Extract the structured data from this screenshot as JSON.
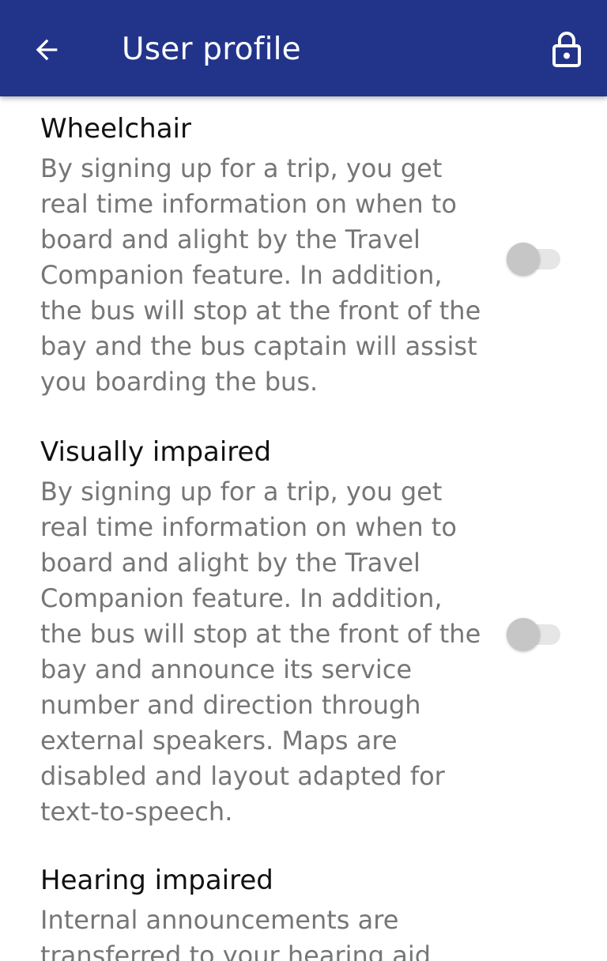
{
  "header": {
    "title": "User profile",
    "back_icon": "arrow-left-icon",
    "lock_icon": "lock-icon",
    "bg_color": "#22348a"
  },
  "preferences": [
    {
      "title": "Wheelchair",
      "description": "By signing up for a trip, you get real time information on when to board and alight by the Travel Companion feature. In addition, the bus will stop at the front of the bay and the bus captain will assist you boarding the bus.",
      "enabled": false
    },
    {
      "title": "Visually impaired",
      "description": "By signing up for a trip, you get real time information on when to board and alight by the Travel Companion feature. In addition, the bus will stop at the front of the bay and announce its service number and direction through external speakers. Maps are disabled and layout adapted for text-to-speech.",
      "enabled": false
    },
    {
      "title": "Hearing impaired",
      "description": "Internal announcements are transferred to your hearing aid",
      "enabled": false
    }
  ]
}
